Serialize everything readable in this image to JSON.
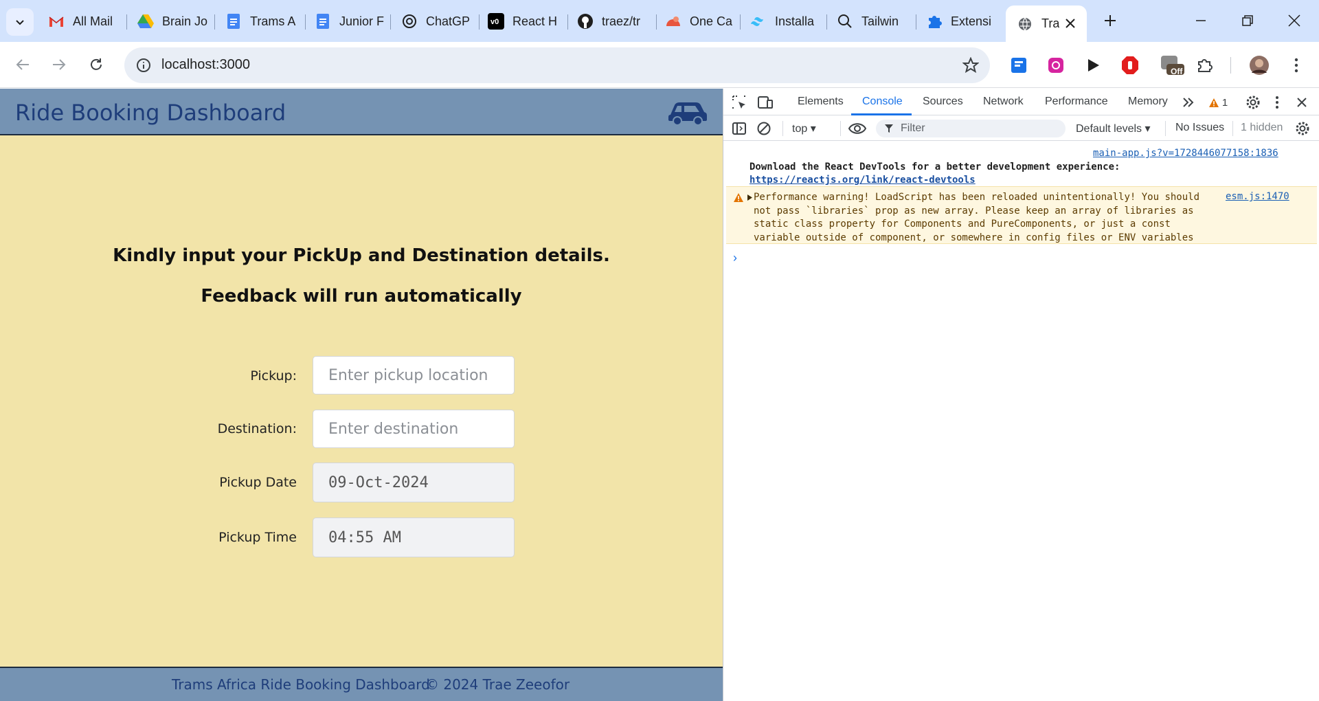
{
  "browser": {
    "tabs": [
      {
        "label": "All Mail",
        "icon": "gmail-icon"
      },
      {
        "label": "Brain Jo",
        "icon": "google-drive-icon"
      },
      {
        "label": "Trams A",
        "icon": "google-docs-icon"
      },
      {
        "label": "Junior F",
        "icon": "google-docs-icon"
      },
      {
        "label": "ChatGP",
        "icon": "chatgpt-icon"
      },
      {
        "label": "React H",
        "icon": "v0-icon"
      },
      {
        "label": "traez/tr",
        "icon": "github-icon"
      },
      {
        "label": "One Ca",
        "icon": "one-cat-icon"
      },
      {
        "label": "Installa",
        "icon": "tailwind-icon"
      },
      {
        "label": "Tailwin",
        "icon": "search-icon"
      },
      {
        "label": "Extensi",
        "icon": "puzzle-icon"
      },
      {
        "label": "Tra",
        "icon": "globe-icon",
        "active": true
      }
    ],
    "url": "localhost:3000",
    "extensions_badge": "Off"
  },
  "app": {
    "title": "Ride Booking Dashboard",
    "prompt_line1": "Kindly input your PickUp and Destination details.",
    "prompt_line2": "Feedback will run automatically",
    "form": {
      "pickup_label": "Pickup:",
      "pickup_placeholder": "Enter pickup location",
      "destination_label": "Destination:",
      "destination_placeholder": "Enter destination",
      "date_label": "Pickup Date",
      "date_value": "09-Oct-2024",
      "time_label": "Pickup Time",
      "time_value": "04:55 AM"
    },
    "footer_left": "Trams Africa Ride Booking Dashboard",
    "footer_right": "© 2024 Trae Zeeofor",
    "colors": {
      "header": "#7593b3",
      "background": "#f2e4a9",
      "title": "#1e3d7a"
    }
  },
  "devtools": {
    "tabs": [
      "Elements",
      "Console",
      "Sources",
      "Network",
      "Performance",
      "Memory"
    ],
    "active_tab": "Console",
    "warning_count": "1",
    "context": "top",
    "filter_placeholder": "Filter",
    "levels": "Default levels",
    "issues": "No Issues",
    "hidden": "1 hidden",
    "messages": {
      "info_source": "main-app.js?v=1728446077158:1836",
      "info_text": "Download the React DevTools for a better development experience:",
      "info_link": "https://reactjs.org/link/react-devtools",
      "warn_source": "esm.js:1470",
      "warn_text": "Performance warning! LoadScript has been reloaded unintentionally! You should not pass `libraries` prop as new array. Please keep an array of libraries as static class property for Components and PureComponents, or just a const variable outside of component, or somewhere in config files or ENV variables"
    }
  }
}
